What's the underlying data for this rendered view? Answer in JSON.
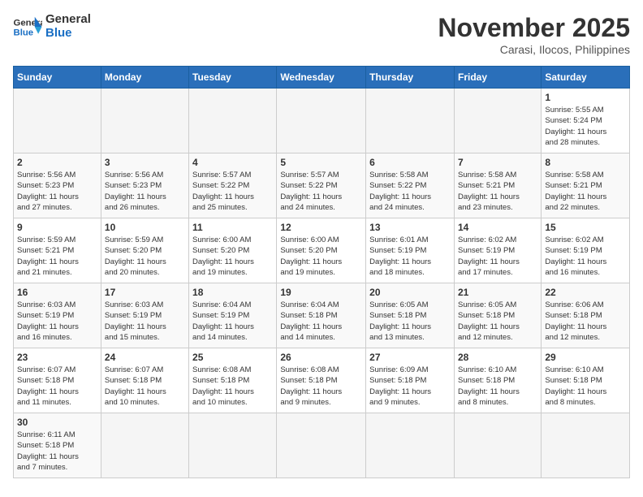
{
  "header": {
    "logo_general": "General",
    "logo_blue": "Blue",
    "month_year": "November 2025",
    "location": "Carasi, Ilocos, Philippines"
  },
  "days_of_week": [
    "Sunday",
    "Monday",
    "Tuesday",
    "Wednesday",
    "Thursday",
    "Friday",
    "Saturday"
  ],
  "weeks": [
    [
      {
        "day": "",
        "info": ""
      },
      {
        "day": "",
        "info": ""
      },
      {
        "day": "",
        "info": ""
      },
      {
        "day": "",
        "info": ""
      },
      {
        "day": "",
        "info": ""
      },
      {
        "day": "",
        "info": ""
      },
      {
        "day": "1",
        "info": "Sunrise: 5:55 AM\nSunset: 5:24 PM\nDaylight: 11 hours\nand 28 minutes."
      }
    ],
    [
      {
        "day": "2",
        "info": "Sunrise: 5:56 AM\nSunset: 5:23 PM\nDaylight: 11 hours\nand 27 minutes."
      },
      {
        "day": "3",
        "info": "Sunrise: 5:56 AM\nSunset: 5:23 PM\nDaylight: 11 hours\nand 26 minutes."
      },
      {
        "day": "4",
        "info": "Sunrise: 5:57 AM\nSunset: 5:22 PM\nDaylight: 11 hours\nand 25 minutes."
      },
      {
        "day": "5",
        "info": "Sunrise: 5:57 AM\nSunset: 5:22 PM\nDaylight: 11 hours\nand 24 minutes."
      },
      {
        "day": "6",
        "info": "Sunrise: 5:58 AM\nSunset: 5:22 PM\nDaylight: 11 hours\nand 24 minutes."
      },
      {
        "day": "7",
        "info": "Sunrise: 5:58 AM\nSunset: 5:21 PM\nDaylight: 11 hours\nand 23 minutes."
      },
      {
        "day": "8",
        "info": "Sunrise: 5:58 AM\nSunset: 5:21 PM\nDaylight: 11 hours\nand 22 minutes."
      }
    ],
    [
      {
        "day": "9",
        "info": "Sunrise: 5:59 AM\nSunset: 5:21 PM\nDaylight: 11 hours\nand 21 minutes."
      },
      {
        "day": "10",
        "info": "Sunrise: 5:59 AM\nSunset: 5:20 PM\nDaylight: 11 hours\nand 20 minutes."
      },
      {
        "day": "11",
        "info": "Sunrise: 6:00 AM\nSunset: 5:20 PM\nDaylight: 11 hours\nand 19 minutes."
      },
      {
        "day": "12",
        "info": "Sunrise: 6:00 AM\nSunset: 5:20 PM\nDaylight: 11 hours\nand 19 minutes."
      },
      {
        "day": "13",
        "info": "Sunrise: 6:01 AM\nSunset: 5:19 PM\nDaylight: 11 hours\nand 18 minutes."
      },
      {
        "day": "14",
        "info": "Sunrise: 6:02 AM\nSunset: 5:19 PM\nDaylight: 11 hours\nand 17 minutes."
      },
      {
        "day": "15",
        "info": "Sunrise: 6:02 AM\nSunset: 5:19 PM\nDaylight: 11 hours\nand 16 minutes."
      }
    ],
    [
      {
        "day": "16",
        "info": "Sunrise: 6:03 AM\nSunset: 5:19 PM\nDaylight: 11 hours\nand 16 minutes."
      },
      {
        "day": "17",
        "info": "Sunrise: 6:03 AM\nSunset: 5:19 PM\nDaylight: 11 hours\nand 15 minutes."
      },
      {
        "day": "18",
        "info": "Sunrise: 6:04 AM\nSunset: 5:19 PM\nDaylight: 11 hours\nand 14 minutes."
      },
      {
        "day": "19",
        "info": "Sunrise: 6:04 AM\nSunset: 5:18 PM\nDaylight: 11 hours\nand 14 minutes."
      },
      {
        "day": "20",
        "info": "Sunrise: 6:05 AM\nSunset: 5:18 PM\nDaylight: 11 hours\nand 13 minutes."
      },
      {
        "day": "21",
        "info": "Sunrise: 6:05 AM\nSunset: 5:18 PM\nDaylight: 11 hours\nand 12 minutes."
      },
      {
        "day": "22",
        "info": "Sunrise: 6:06 AM\nSunset: 5:18 PM\nDaylight: 11 hours\nand 12 minutes."
      }
    ],
    [
      {
        "day": "23",
        "info": "Sunrise: 6:07 AM\nSunset: 5:18 PM\nDaylight: 11 hours\nand 11 minutes."
      },
      {
        "day": "24",
        "info": "Sunrise: 6:07 AM\nSunset: 5:18 PM\nDaylight: 11 hours\nand 10 minutes."
      },
      {
        "day": "25",
        "info": "Sunrise: 6:08 AM\nSunset: 5:18 PM\nDaylight: 11 hours\nand 10 minutes."
      },
      {
        "day": "26",
        "info": "Sunrise: 6:08 AM\nSunset: 5:18 PM\nDaylight: 11 hours\nand 9 minutes."
      },
      {
        "day": "27",
        "info": "Sunrise: 6:09 AM\nSunset: 5:18 PM\nDaylight: 11 hours\nand 9 minutes."
      },
      {
        "day": "28",
        "info": "Sunrise: 6:10 AM\nSunset: 5:18 PM\nDaylight: 11 hours\nand 8 minutes."
      },
      {
        "day": "29",
        "info": "Sunrise: 6:10 AM\nSunset: 5:18 PM\nDaylight: 11 hours\nand 8 minutes."
      }
    ],
    [
      {
        "day": "30",
        "info": "Sunrise: 6:11 AM\nSunset: 5:18 PM\nDaylight: 11 hours\nand 7 minutes."
      },
      {
        "day": "",
        "info": ""
      },
      {
        "day": "",
        "info": ""
      },
      {
        "day": "",
        "info": ""
      },
      {
        "day": "",
        "info": ""
      },
      {
        "day": "",
        "info": ""
      },
      {
        "day": "",
        "info": ""
      }
    ]
  ]
}
